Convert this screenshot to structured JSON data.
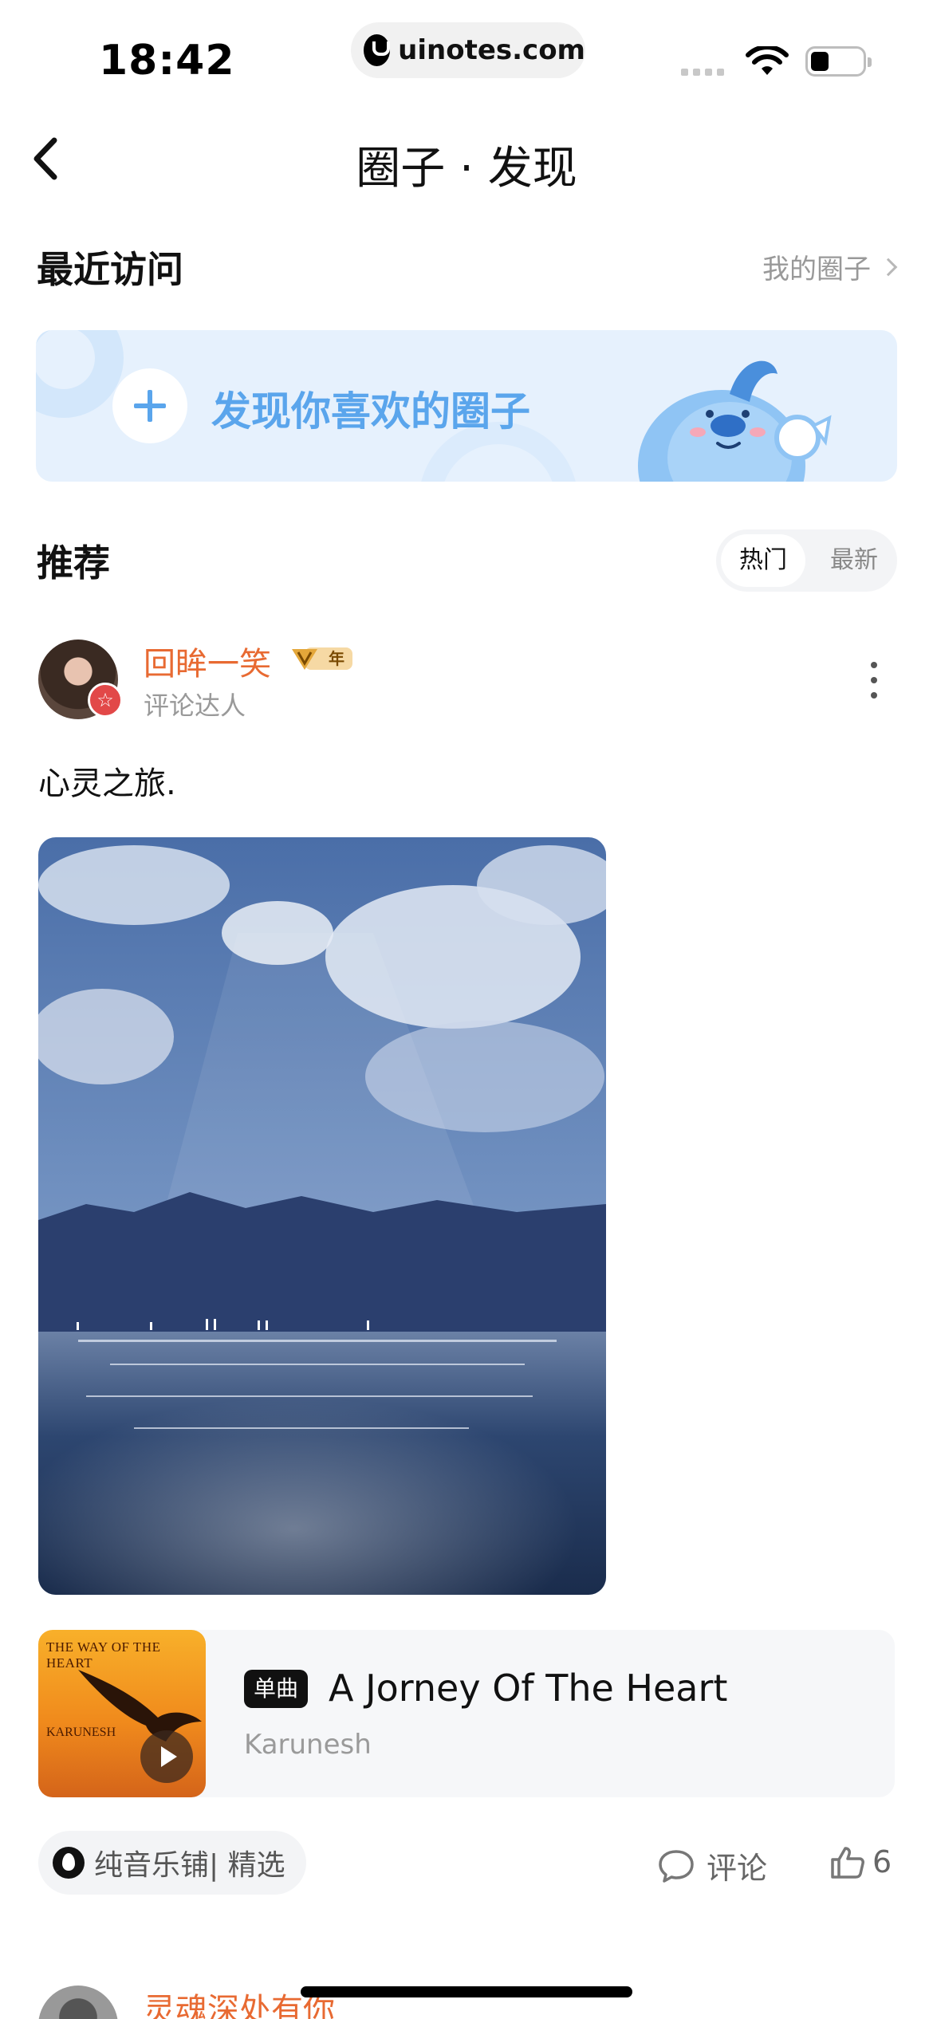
{
  "status_bar": {
    "time": "18:42",
    "url": "uinotes.com"
  },
  "nav": {
    "title": "圈子 · 发现"
  },
  "recent": {
    "title": "最近访问",
    "link_label": "我的圈子",
    "banner_text": "发现你喜欢的圈子"
  },
  "recommend": {
    "title": "推荐",
    "tabs": [
      {
        "label": "热门",
        "selected": true
      },
      {
        "label": "最新",
        "selected": false
      }
    ]
  },
  "post": {
    "username": "回眸一笑",
    "vip_badge": "年",
    "user_tag": "评论达人",
    "text": "心灵之旅.",
    "music": {
      "badge": "单曲",
      "title": "A Jorney Of The Heart",
      "artist": "Karunesh",
      "album_title": "THE WAY OF THE HEART",
      "album_artist": "KARUNESH"
    },
    "circle": "纯音乐铺| 精选",
    "comment_label": "评论",
    "like_count": "6"
  },
  "next_post": {
    "username": "灵魂深处有你"
  },
  "colors": {
    "accent_blue": "#5aa5ec",
    "username_orange": "#e86a32",
    "banner_bg": "#e6f1fd"
  }
}
